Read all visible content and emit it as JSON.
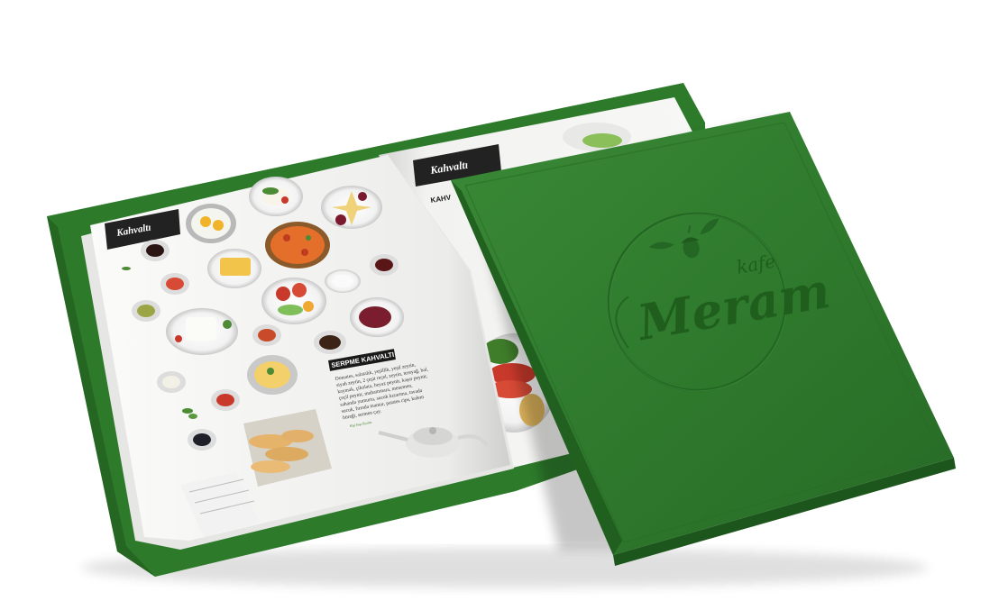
{
  "colors": {
    "cover_green": "#2f7a2d",
    "cover_green_dark": "#1f5e1d",
    "page_white": "#f3f3f1",
    "label_black": "#222222",
    "accent_red": "#c8392b"
  },
  "cover": {
    "brand_small": "kafe",
    "brand_large": "Meram"
  },
  "left_page": {
    "section_label": "Kahvaltı",
    "item_title": "SERPME KAHVALTI",
    "description_lines": [
      "Domates, salatalık, yeşillik, yeşil zeytin,",
      "siyah zeytin, 2 çeşit reçel, zeytin, tereyağ, bal,",
      "kaymak, çikolata, beyaz peynir, kaşar peynir,",
      "çeçil peynir, muhammara, menemen,",
      "sahanda yumurta, sucuk kızartma, tavada",
      "sucuk, fırında mantar, patates cips, kalem",
      "böreği, sermen çay."
    ],
    "footnote": "Kişi başı fiyattır."
  },
  "right_page": {
    "section_label": "Kahvaltı",
    "item_title_partial": "KAHV"
  },
  "icons": [
    "leaf-icon",
    "acorn-icon"
  ]
}
